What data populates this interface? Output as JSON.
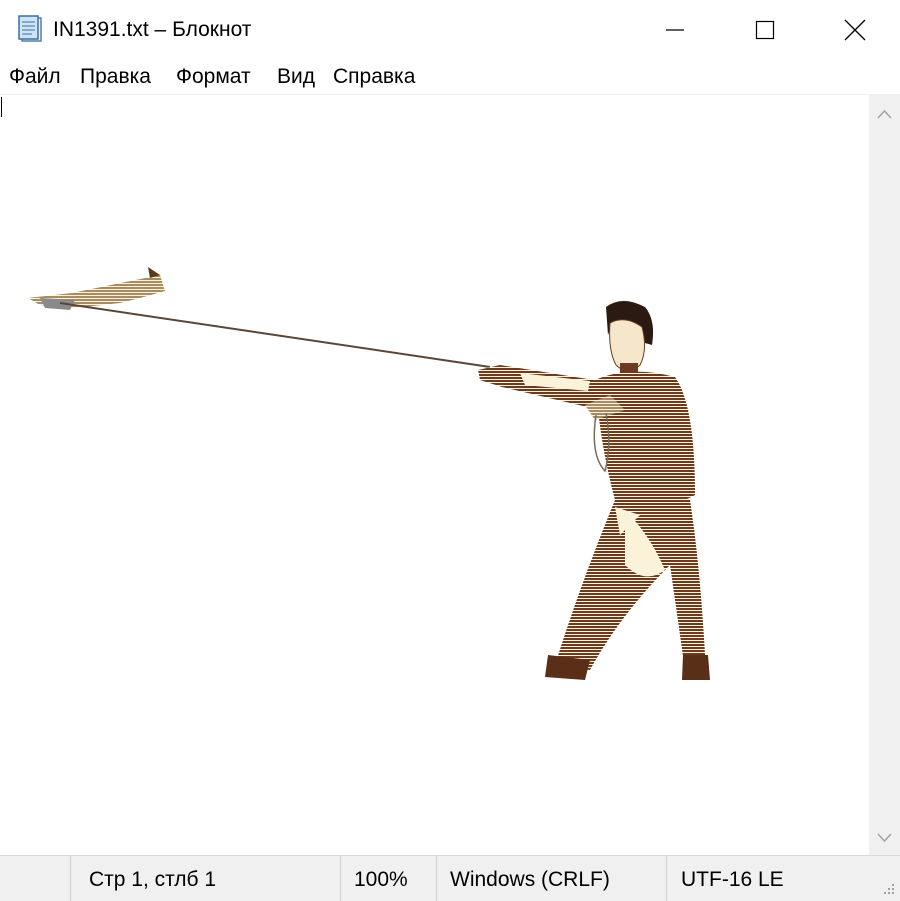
{
  "window": {
    "title": "IN1391.txt – Блокнот",
    "icon": "notepad-icon"
  },
  "menu": [
    "Файл",
    "Правка",
    "Формат",
    "Вид",
    "Справка"
  ],
  "status": {
    "position": "Стр 1, стлб 1",
    "zoom": "100%",
    "line_endings": "Windows (CRLF)",
    "encoding": "UTF-16 LE"
  },
  "colors": {
    "status_bg": "#f0f0f0",
    "scrollbar_bg": "#f0f0f0",
    "art_brown": "#6b3a1f",
    "art_cream": "#fbf3d9"
  }
}
